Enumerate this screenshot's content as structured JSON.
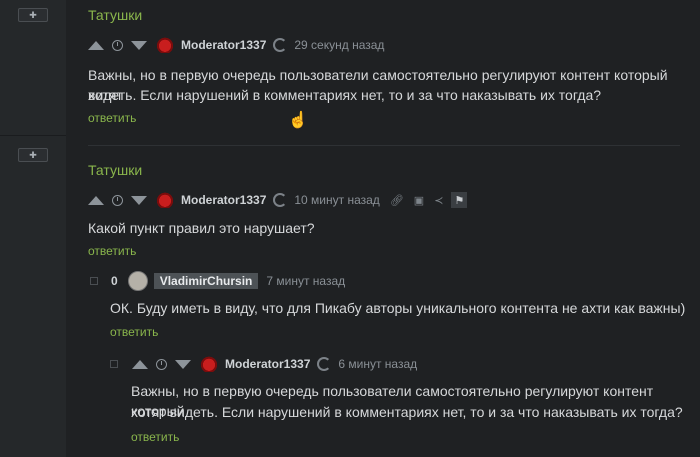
{
  "comments": [
    {
      "tag": "Татушки",
      "author": "Moderator1337",
      "time": "29 секунд назад",
      "text_line1": "Важны, но в первую очередь пользователи самостоятельно регулируют контент который хотят",
      "text_line2": "видеть. Если нарушений в комментариях нет, то и за что наказывать их тогда?",
      "reply": "ответить"
    },
    {
      "tag": "Татушки",
      "author": "Moderator1337",
      "time": "10 минут назад",
      "text": "Какой пункт правил это нарушает?",
      "reply": "ответить"
    },
    {
      "score": "0",
      "author": "VladimirChursin",
      "time": "7 минут назад",
      "text": "ОК. Буду иметь в виду, что для Пикабу авторы уникального контента не ахти как важны)",
      "reply": "ответить"
    },
    {
      "author": "Moderator1337",
      "time": "6 минут назад",
      "text_line1": "Важны, но в первую очередь пользователи самостоятельно регулируют контент который",
      "text_line2": "хотят видеть. Если нарушений в комментариях нет, то и за что наказывать их тогда?",
      "reply": "ответить"
    }
  ],
  "icons": {
    "expand": "plus-icon",
    "link": "link-icon",
    "save": "save-icon",
    "share": "share-icon",
    "flag": "flag-icon"
  },
  "colors": {
    "accent": "#8ab64c",
    "background": "#1f2123"
  }
}
